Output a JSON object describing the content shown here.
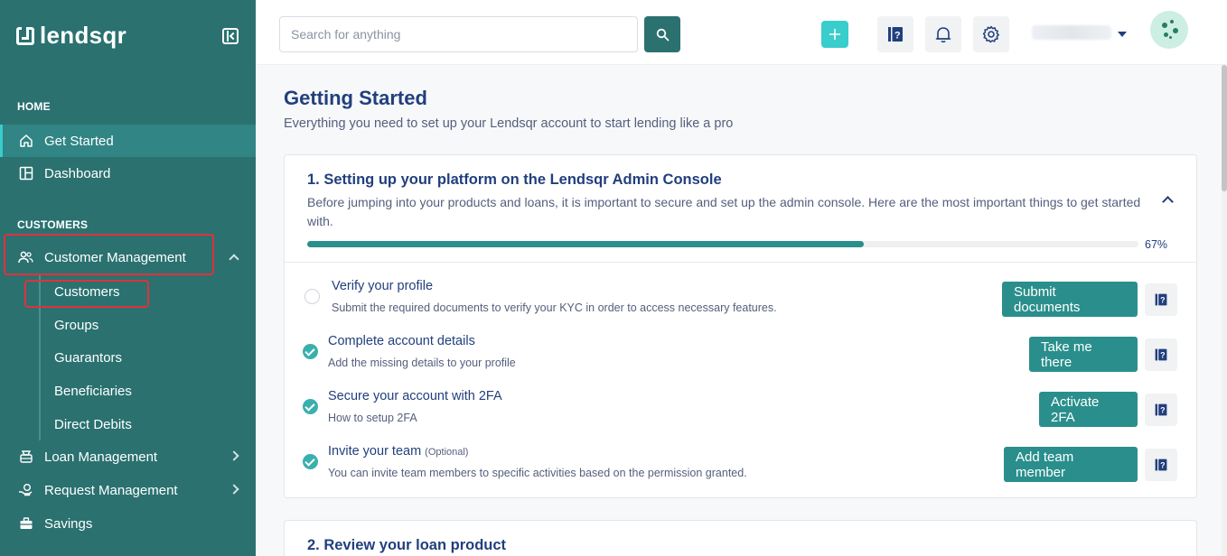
{
  "app": {
    "logo_text": "lendsqr"
  },
  "colors": {
    "sidebar": "#2a7170",
    "accent": "#39cdcc",
    "primary_button": "#2a8f8c",
    "highlight": "#e0323a"
  },
  "sidebar": {
    "sections": [
      {
        "label": "HOME"
      },
      {
        "label": "CUSTOMERS"
      }
    ],
    "home_items": [
      {
        "label": "Get Started",
        "icon": "home-icon",
        "active": true
      },
      {
        "label": "Dashboard",
        "icon": "dashboard-icon"
      }
    ],
    "customer_items": [
      {
        "label": "Customer Management",
        "icon": "users-icon",
        "expanded": true
      },
      {
        "label": "Loan Management",
        "icon": "loan-icon"
      },
      {
        "label": "Request Management",
        "icon": "request-icon"
      },
      {
        "label": "Savings",
        "icon": "briefcase-icon"
      }
    ],
    "sub_items": [
      "Customers",
      "Groups",
      "Guarantors",
      "Beneficiaries",
      "Direct Debits"
    ]
  },
  "topbar": {
    "search_placeholder": "Search for anything",
    "icons": [
      "search-icon",
      "plus-icon",
      "help-icon",
      "bell-icon",
      "gear-icon",
      "chevron-down-icon",
      "avatar"
    ]
  },
  "main": {
    "title": "Getting Started",
    "subtitle": "Everything you need to set up your Lendsqr account to start lending like a pro",
    "card1": {
      "title": "1. Setting up your platform on the Lendsqr Admin Console",
      "description": "Before jumping into your products and loans, it is important to secure and set up the admin console. Here are the most important things to get started with.",
      "progress": 0.67,
      "progress_label": "67%",
      "tasks": [
        {
          "title": "Verify your profile",
          "optional": "",
          "desc": "Submit the required documents to verify your KYC in order to access necessary features.",
          "button": "Submit documents",
          "done": false
        },
        {
          "title": "Complete account details",
          "optional": "",
          "desc": "Add the missing details to your profile",
          "button": "Take me there",
          "done": true
        },
        {
          "title": "Secure your account with 2FA",
          "optional": "",
          "desc": "How to setup 2FA",
          "button": "Activate 2FA",
          "done": true
        },
        {
          "title": "Invite your team",
          "optional": "(Optional)",
          "desc": "You can invite team members to specific activities based on the permission granted.",
          "button": "Add team member",
          "done": true
        }
      ]
    },
    "card2": {
      "title": "2. Review your loan product"
    }
  }
}
